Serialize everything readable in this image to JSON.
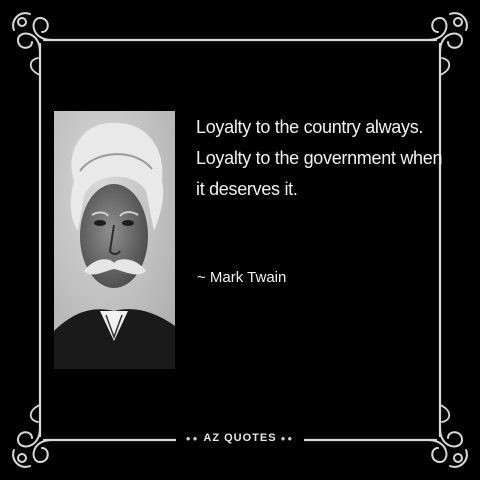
{
  "quote": {
    "lines": [
      "Loyalty to the country always.",
      "Loyalty to the government when",
      "it deserves it."
    ]
  },
  "author": "~ Mark Twain",
  "brand": {
    "name": "AZ QUOTES"
  },
  "colors": {
    "background": "#000000",
    "text": "#f2f2f2",
    "frame": "#d9d9d9"
  },
  "icons": {
    "corner_ornament": "scroll-flourish-icon",
    "portrait": "portrait-photo"
  }
}
